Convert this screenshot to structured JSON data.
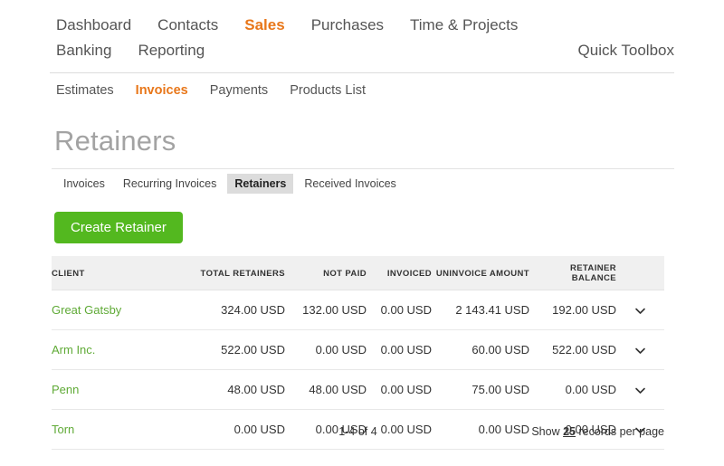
{
  "top_nav": {
    "row1": [
      {
        "label": "Dashboard",
        "active": false
      },
      {
        "label": "Contacts",
        "active": false
      },
      {
        "label": "Sales",
        "active": true
      },
      {
        "label": "Purchases",
        "active": false
      },
      {
        "label": "Time & Projects",
        "active": false
      }
    ],
    "row2": [
      {
        "label": "Banking",
        "active": false
      },
      {
        "label": "Reporting",
        "active": false
      }
    ],
    "quick_toolbox": "Quick Toolbox"
  },
  "sub_nav": [
    {
      "label": "Estimates",
      "active": false
    },
    {
      "label": "Invoices",
      "active": true
    },
    {
      "label": "Payments",
      "active": false
    },
    {
      "label": "Products List",
      "active": false
    }
  ],
  "page": {
    "title": "Retainers"
  },
  "section_tabs": [
    {
      "label": "Invoices",
      "active": false
    },
    {
      "label": "Recurring Invoices",
      "active": false
    },
    {
      "label": "Retainers",
      "active": true
    },
    {
      "label": "Received Invoices",
      "active": false
    }
  ],
  "actions": {
    "create_retainer": "Create Retainer"
  },
  "table": {
    "columns": [
      "CLIENT",
      "TOTAL RETAINERS",
      "NOT PAID",
      "INVOICED",
      "UNINVOICE AMOUNT",
      "RETAINER BALANCE"
    ],
    "rows": [
      {
        "client": "Great Gatsby",
        "total_retainers": "324.00 USD",
        "not_paid": "132.00 USD",
        "invoiced": "0.00 USD",
        "uninvoice_amount": "2 143.41 USD",
        "retainer_balance": "192.00 USD"
      },
      {
        "client": "Arm Inc.",
        "total_retainers": "522.00 USD",
        "not_paid": "0.00 USD",
        "invoiced": "0.00 USD",
        "uninvoice_amount": "60.00 USD",
        "retainer_balance": "522.00 USD"
      },
      {
        "client": "Penn",
        "total_retainers": "48.00 USD",
        "not_paid": "48.00 USD",
        "invoiced": "0.00 USD",
        "uninvoice_amount": "75.00 USD",
        "retainer_balance": "0.00 USD"
      },
      {
        "client": "Torn",
        "total_retainers": "0.00 USD",
        "not_paid": "0.00 USD",
        "invoiced": "0.00 USD",
        "uninvoice_amount": "0.00 USD",
        "retainer_balance": "0.00 USD"
      }
    ],
    "row_expand_icon": "chevron-down-icon"
  },
  "footer": {
    "range": "1-4 of 4",
    "show_prefix": "Show",
    "per_page": "25",
    "show_suffix": "records per page"
  },
  "colors": {
    "accent_orange": "#e8771a",
    "accent_green": "#53b81f",
    "client_link_green": "#5faa36",
    "title_gray": "#a3a3a3",
    "table_header_bg": "#f0f0f0",
    "active_tab_bg": "#dcdcdc"
  }
}
